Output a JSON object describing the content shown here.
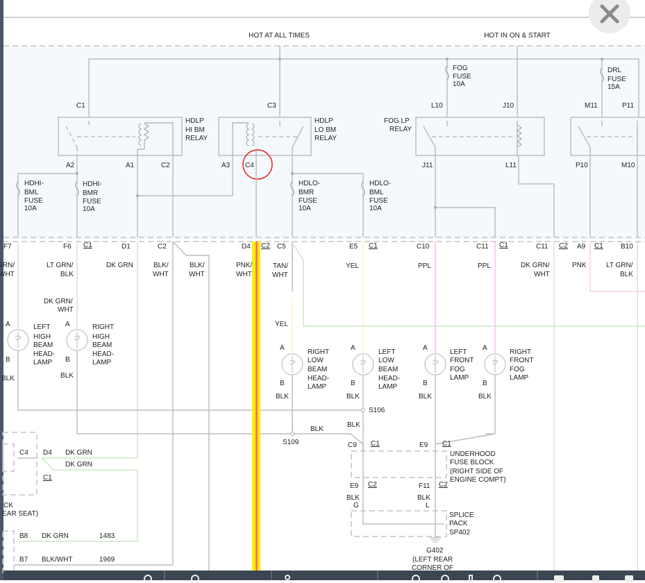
{
  "header": {
    "hot_all_times": "HOT AT ALL TIMES",
    "hot_on_start": "HOT IN ON & START"
  },
  "close_icon": "close-icon",
  "relays": {
    "hi": [
      "HDLP",
      "HI BM",
      "RELAY"
    ],
    "lo": [
      "HDLP",
      "LO BM",
      "RELAY"
    ],
    "fog": [
      "FOG LP",
      "RELAY"
    ]
  },
  "fuses": {
    "fog": [
      "FOG",
      "FUSE",
      "10A"
    ],
    "drl": [
      "DRL",
      "FUSE",
      "15A"
    ],
    "hdhi_bml": [
      "HDHI-",
      "BML",
      "FUSE",
      "10A"
    ],
    "hdhi_bmr": [
      "HDHI-",
      "BMR",
      "FUSE",
      "10A"
    ],
    "hdlo_bmr": [
      "HDLO-",
      "BMR",
      "FUSE",
      "10A"
    ],
    "hdlo_bml": [
      "HDLO-",
      "BML",
      "FUSE",
      "10A"
    ]
  },
  "pins_top": {
    "c1": "C1",
    "c3": "C3",
    "l10": "L10",
    "j10": "J10",
    "m11": "M11",
    "p11": "P11"
  },
  "pins_relay": {
    "a2": "A2",
    "a1": "A1",
    "c2": "C2",
    "a3": "A3",
    "c4": "C4",
    "j11": "J11",
    "l11": "L11",
    "p10": "P10",
    "m10": "M10"
  },
  "connectors": [
    "F7",
    "F6",
    "C1",
    "D1",
    "C2",
    "D4",
    "C2",
    "C5",
    "E5",
    "C1",
    "C10",
    "C11",
    "C1",
    "C11",
    "C2",
    "A9",
    "C1",
    "B10"
  ],
  "wire_colors": {
    "f7": [
      "GRN/",
      "WHT"
    ],
    "f6": [
      "LT GRN/",
      "BLK"
    ],
    "f6b": [
      "DK GRN/",
      "WHT"
    ],
    "d1": "DK GRN",
    "c2a": [
      "BLK/",
      "WHT"
    ],
    "c2b": [
      "BLK/",
      "WHT"
    ],
    "d4": [
      "PNK/",
      "WHT"
    ],
    "c5": [
      "TAN/",
      "WHT"
    ],
    "c5b": "YEL",
    "e5": "YEL",
    "c10": "PPL",
    "c11": "PPL",
    "c11b": [
      "DK GRN/",
      "WHT"
    ],
    "a9": "PNK",
    "b10": [
      "LT GRN/",
      "BLK"
    ]
  },
  "lamps": [
    {
      "name": [
        "LEFT",
        "HIGH",
        "BEAM",
        "HEAD-",
        "LAMP"
      ],
      "a": "A",
      "b": "B",
      "ground": "BLK"
    },
    {
      "name": [
        "RIGHT",
        "HIGH",
        "BEAM",
        "HEAD-",
        "LAMP"
      ],
      "a": "A",
      "b": "B",
      "ground": "BLK"
    },
    {
      "name": [
        "RIGHT",
        "LOW",
        "BEAM",
        "HEAD-",
        "LAMP"
      ],
      "a": "A",
      "b": "B",
      "ground": "BLK"
    },
    {
      "name": [
        "LEFT",
        "LOW",
        "BEAM",
        "HEAD-",
        "LAMP"
      ],
      "a": "A",
      "b": "B",
      "ground": "BLK"
    },
    {
      "name": [
        "LEFT",
        "FRONT",
        "FOG",
        "LAMP"
      ],
      "a": "A",
      "b": "B",
      "ground": "BLK"
    },
    {
      "name": [
        "RIGHT",
        "FRONT",
        "FOG",
        "LAMP"
      ],
      "a": "A",
      "b": "B",
      "ground": "BLK"
    }
  ],
  "splices": {
    "s106": "S106",
    "s109": "S109",
    "blk1": "BLK",
    "blk2": "BLK"
  },
  "underhood": {
    "lines": [
      "UNDERHOOD",
      "FUSE BLOCK",
      "(RIGHT SIDE OF",
      "ENGINE COMPT)"
    ],
    "c9": "C9",
    "c1a": "C1",
    "e9": "E9",
    "c1b": "C1",
    "e9b": "E9",
    "c2a": "C2",
    "f11": "F11",
    "c2b": "C2"
  },
  "splice_pack": {
    "lines": [
      "SPLICE",
      "PACK",
      "SP402"
    ],
    "blk_g": "BLK",
    "g": "G",
    "blk_l": "BLK",
    "l": "L"
  },
  "ground": {
    "lines": [
      "G402",
      "(LEFT REAR",
      "CORNER OF"
    ]
  },
  "left_module": {
    "c4": "C4",
    "d4": "D4",
    "c1": "C1",
    "wire1": "DK GRN",
    "wire2": "DK GRN",
    "label": [
      "CK",
      "EAR SEAT)"
    ]
  },
  "left_bottom": [
    {
      "pin": "B8",
      "color": "DK GRN",
      "circuit": "1483"
    },
    {
      "pin": "B7",
      "color": "BLK/WHT",
      "circuit": "1969"
    }
  ],
  "highlight_color": "#e02020",
  "toolbar": {
    "icons": [
      "zoom-out-icon",
      "zoom-in-icon",
      "pan-icon",
      "rotate-left-icon",
      "rotate-right-icon",
      "fit-icon",
      "rotate-icon",
      "print-icon",
      "download-icon",
      "page-icon"
    ]
  }
}
